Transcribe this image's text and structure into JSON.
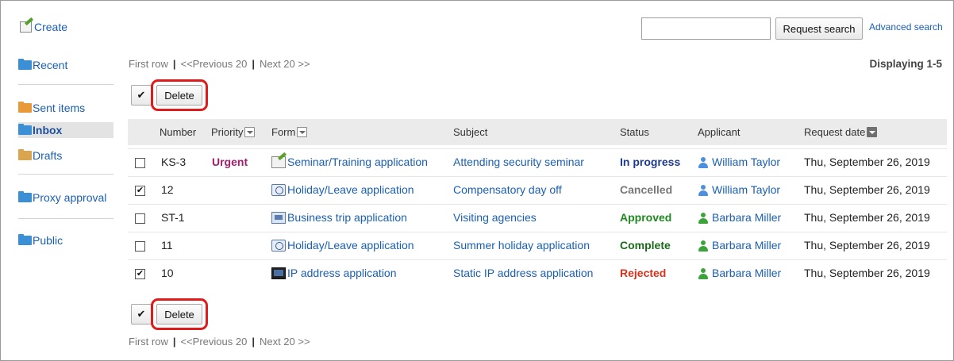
{
  "toolbar": {
    "create_label": "Create",
    "search_value": "",
    "search_button": "Request search",
    "advanced_search": "Advanced search"
  },
  "sidebar": {
    "items": [
      {
        "label": "Recent",
        "icon": "folder-icon"
      },
      {
        "label": "Sent items",
        "icon": "folder-icon"
      },
      {
        "label": "Inbox",
        "icon": "folder-icon",
        "active": true
      },
      {
        "label": "Drafts",
        "icon": "folder-icon"
      },
      {
        "label": "Proxy approval",
        "icon": "folder-icon"
      },
      {
        "label": "Public",
        "icon": "folder-icon"
      }
    ]
  },
  "pager": {
    "first": "First row",
    "prev": "<<Previous 20",
    "next": "Next 20 >>",
    "separator": "|",
    "displaying": "Displaying 1-5"
  },
  "actions": {
    "check_symbol": "✔",
    "delete_label": "Delete"
  },
  "table": {
    "headers": {
      "number": "Number",
      "priority": "Priority",
      "form": "Form",
      "subject": "Subject",
      "status": "Status",
      "applicant": "Applicant",
      "request_date": "Request date"
    },
    "rows": [
      {
        "checked": false,
        "number": "KS-3",
        "priority": "Urgent",
        "form": "Seminar/Training application",
        "form_icon": "seminar-form-icon",
        "subject": "Attending security seminar",
        "status": "In progress",
        "applicant": "William Taylor",
        "date": "Thu, September 26, 2019"
      },
      {
        "checked": true,
        "number": "12",
        "priority": "",
        "form": "Holiday/Leave application",
        "form_icon": "holiday-form-icon",
        "subject": "Compensatory day off",
        "status": "Cancelled",
        "applicant": "William Taylor",
        "date": "Thu, September 26, 2019"
      },
      {
        "checked": false,
        "number": "ST-1",
        "priority": "",
        "form": "Business trip application",
        "form_icon": "trip-form-icon",
        "subject": "Visiting agencies",
        "status": "Approved",
        "applicant": "Barbara Miller",
        "date": "Thu, September 26, 2019"
      },
      {
        "checked": false,
        "number": "11",
        "priority": "",
        "form": "Holiday/Leave application",
        "form_icon": "holiday-form-icon",
        "subject": "Summer holiday application",
        "status": "Complete",
        "applicant": "Barbara Miller",
        "date": "Thu, September 26, 2019"
      },
      {
        "checked": true,
        "number": "10",
        "priority": "",
        "form": "IP address application",
        "form_icon": "ip-form-icon",
        "subject": "Static IP address application",
        "status": "Rejected",
        "applicant": "Barbara Miller",
        "date": "Thu, September 26, 2019"
      }
    ]
  },
  "colors": {
    "link": "#1a5fb4",
    "urgent": "#a0206e",
    "status_in_progress": "#1f3a93",
    "status_cancelled": "#777777",
    "status_approved": "#1e8a1e",
    "status_complete": "#1a6b1a",
    "status_rejected": "#d8321b",
    "user_blue": "#4a8fe0",
    "user_green": "#3aa43a",
    "highlight": "#e01b1b"
  }
}
